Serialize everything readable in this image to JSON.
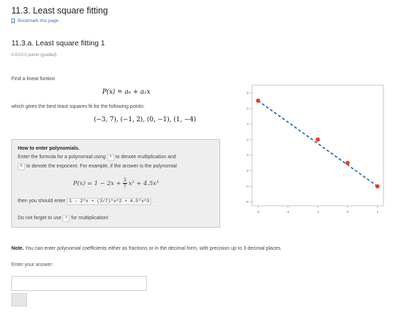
{
  "section": {
    "title": "11.3. Least square fitting",
    "bookmark_label": "Bookmark this page"
  },
  "problem": {
    "title": "11.3.a. Least square fitting 1",
    "points_label": "0.0/10.0 points (graded)",
    "intro": "Find a linear funtion",
    "formula": "P(x) = a₀ + a₁x",
    "fit_text": "which gives the best least squares fit for the following points:",
    "points_list": "(−3, 7),  (−1, 2),  (0, −1),  (1, −4)"
  },
  "howto": {
    "title": "How to enter polynomials.",
    "line1_a": "Enter the formula for a polynomial using",
    "line1_code": "*",
    "line1_b": "to denote multiplication and",
    "line2_code": "^",
    "line2_b": "to denote the exponent. For example, if the answer is the polynomial",
    "example_lhs": "P(x) = 1 − 2x +",
    "example_num": "3",
    "example_den": "7",
    "example_rhs": "x² + 4.5x³",
    "line3_a": "then you should enter",
    "line3_code": "1 - 2*x + (3/7)*x^2 + 4.5*x^3",
    "line3_b": ".",
    "line4_a": "Do not forget to use",
    "line4_code": "*",
    "line4_b": "for multiplication!"
  },
  "note": {
    "bold": "Note.",
    "text": "You can enter polynomial coefficients either as fractions or in the decimal form, with precision up to 3 decimal places."
  },
  "answer": {
    "label": "Enter your answer:",
    "value": ""
  },
  "colors": {
    "point": "#e8401c",
    "fit_line": "#2e6fa8",
    "link": "#3b73b9"
  },
  "chart_data": {
    "type": "scatter",
    "points": [
      {
        "x": -3,
        "y": 7
      },
      {
        "x": -1,
        "y": 2
      },
      {
        "x": 0,
        "y": -1
      },
      {
        "x": 1,
        "y": -4
      }
    ],
    "fit_line": {
      "x": [
        -3,
        1
      ],
      "y": [
        7,
        -4
      ],
      "style": "dashed"
    },
    "xlim": [
      -3.2,
      1.2
    ],
    "ylim": [
      -6.5,
      9
    ],
    "xticks": [
      "-3",
      "-2",
      "-1",
      "0",
      "1"
    ],
    "yticks": [
      "-6",
      "-4",
      "-2",
      "0",
      "2",
      "4",
      "6",
      "8"
    ],
    "grid": false
  }
}
